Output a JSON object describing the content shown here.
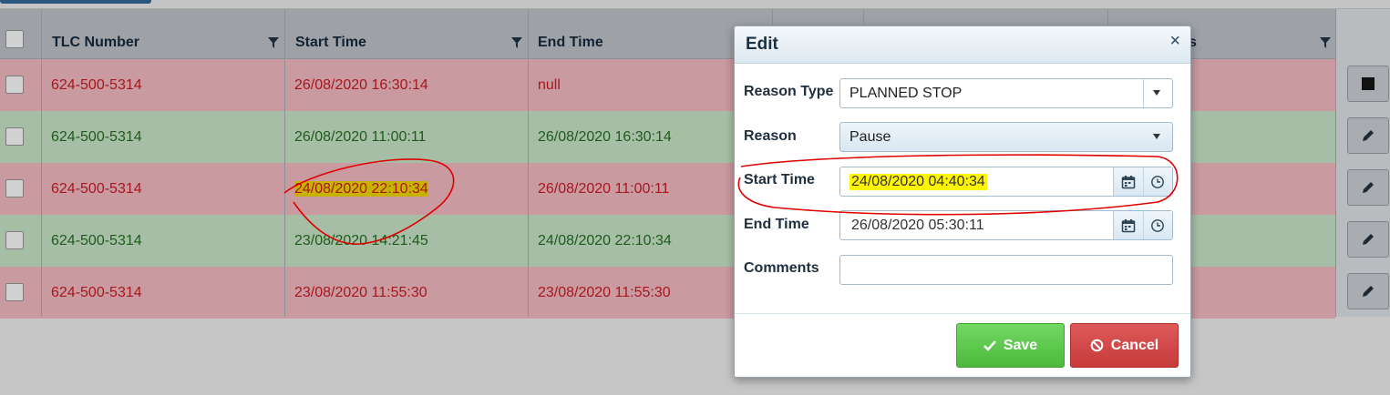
{
  "grid": {
    "columns": [
      {
        "label": "TLC Number"
      },
      {
        "label": "Start Time"
      },
      {
        "label": "End Time"
      },
      {
        "label": ""
      },
      {
        "label": ""
      },
      {
        "label": "s"
      }
    ],
    "rows": [
      {
        "status": "red",
        "tlc": "624-500-5314",
        "start": "26/08/2020 16:30:14",
        "end": "null",
        "action": "stop-icon"
      },
      {
        "status": "green",
        "tlc": "624-500-5314",
        "start": "26/08/2020 11:00:11",
        "end": "26/08/2020 16:30:14",
        "action": "pencil-icon"
      },
      {
        "status": "red",
        "tlc": "624-500-5314",
        "start": "24/08/2020 22:10:34",
        "end": "26/08/2020 11:00:11",
        "action": "pencil-icon"
      },
      {
        "status": "green",
        "tlc": "624-500-5314",
        "start": "23/08/2020 14:21:45",
        "end": "24/08/2020 22:10:34",
        "action": "pencil-icon"
      },
      {
        "status": "red",
        "tlc": "624-500-5314",
        "start": "23/08/2020 11:55:30",
        "end": "23/08/2020 11:55:30",
        "action": "pencil-icon"
      }
    ]
  },
  "modal": {
    "title": "Edit",
    "close": "×",
    "reason_type_label": "Reason Type",
    "reason_type_value": "PLANNED STOP",
    "reason_label": "Reason",
    "reason_value": "Pause",
    "start_time_label": "Start Time",
    "start_time_value": "24/08/2020 04:40:34",
    "end_time_label": "End Time",
    "end_time_value": "26/08/2020 05:30:11",
    "comments_label": "Comments",
    "comments_value": "",
    "save_label": "Save",
    "cancel_label": "Cancel"
  },
  "colors": {
    "row_red": "#c99aa0",
    "row_green": "#a7bea6",
    "text_red": "#a8161e",
    "text_green": "#1e5b1c",
    "save": "#5cc84b",
    "cancel": "#d64a4a",
    "annotation": "#e00000",
    "highlight_yellow": "#fff500"
  }
}
